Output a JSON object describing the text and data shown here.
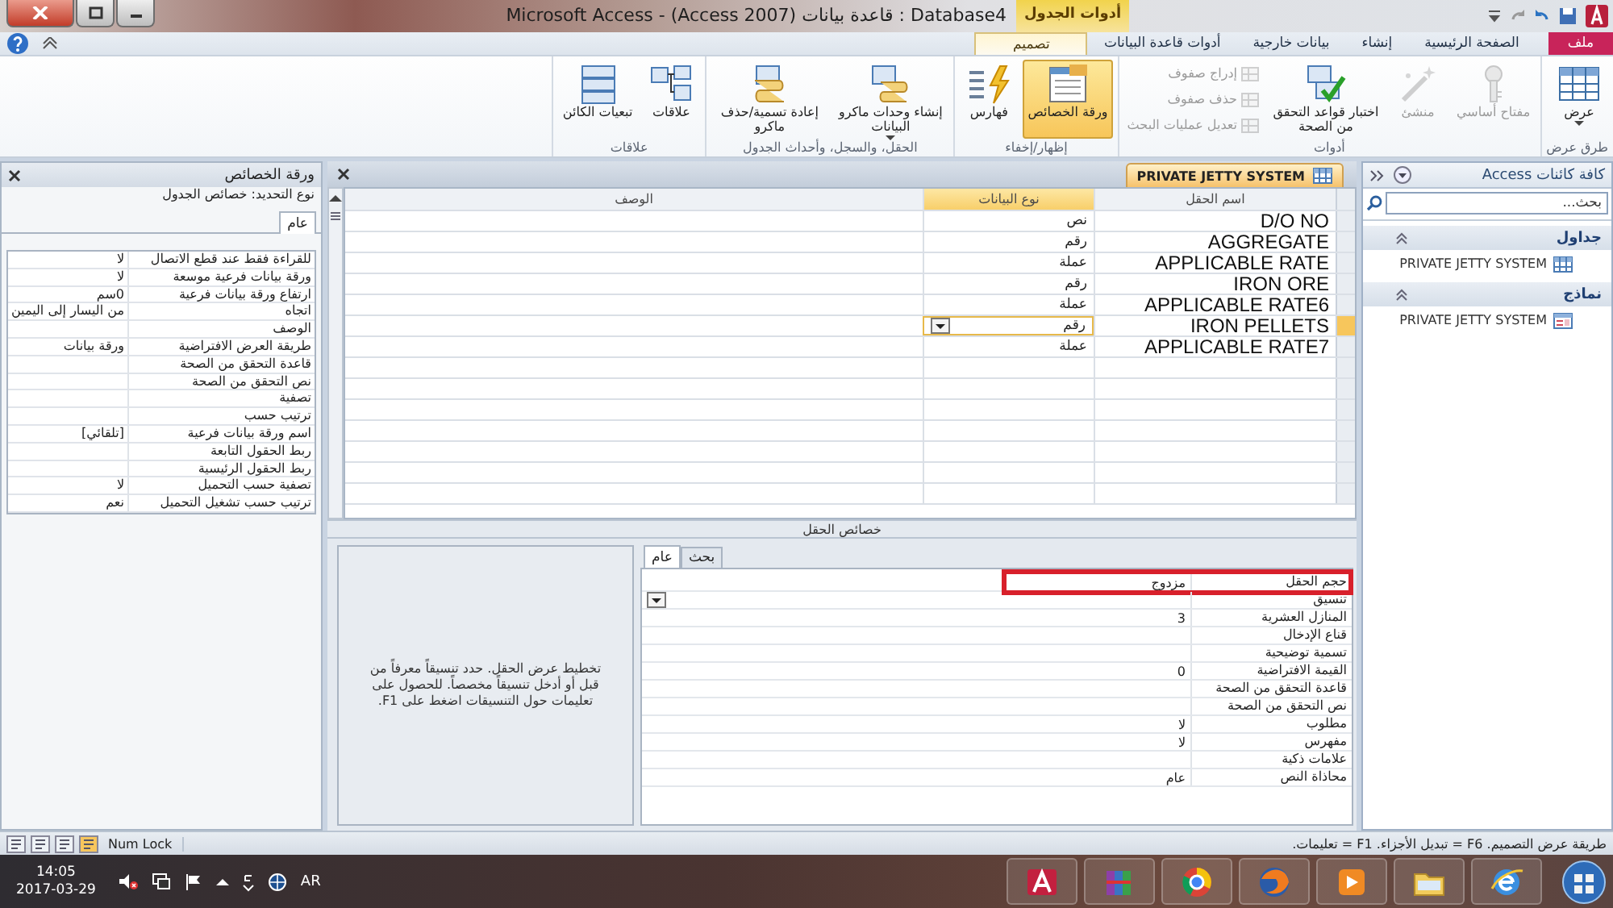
{
  "window": {
    "title": "Microsoft Access - (Access 2007) قاعدة بيانات : Database4",
    "contextual_label": "أدوات الجدول"
  },
  "ribbon_tabs": [
    {
      "label": "ملف",
      "kind": "file",
      "selected": false
    },
    {
      "label": "الصفحة الرئيسية",
      "kind": "tab",
      "selected": false
    },
    {
      "label": "إنشاء",
      "kind": "tab",
      "selected": false
    },
    {
      "label": "بيانات خارجية",
      "kind": "tab",
      "selected": false
    },
    {
      "label": "أدوات قاعدة البيانات",
      "kind": "tab",
      "selected": false
    },
    {
      "label": "تصميم",
      "kind": "tab",
      "selected": true
    }
  ],
  "ribbon_groups": [
    {
      "label": "طرق عرض",
      "buttons": [
        {
          "label": "عرض",
          "kind": "large",
          "disabled": false,
          "selected": false,
          "dropdown": true
        }
      ]
    },
    {
      "label": "أدوات",
      "buttons": [
        {
          "label": "مفتاح أساسي",
          "kind": "large",
          "disabled": true,
          "selected": false,
          "dropdown": false
        },
        {
          "label": "منشئ",
          "kind": "large",
          "disabled": true,
          "selected": false,
          "dropdown": false
        },
        {
          "label": "اختبار قواعد التحقق من الصحة",
          "kind": "large",
          "disabled": false,
          "selected": false,
          "dropdown": false
        },
        {
          "label": "إدراج صفوف",
          "kind": "small",
          "disabled": true,
          "selected": false,
          "dropdown": false
        },
        {
          "label": "حذف صفوف",
          "kind": "small",
          "disabled": true,
          "selected": false,
          "dropdown": false
        },
        {
          "label": "تعديل عمليات البحث",
          "kind": "small",
          "disabled": true,
          "selected": false,
          "dropdown": false
        }
      ]
    },
    {
      "label": "إظهار/إخفاء",
      "buttons": [
        {
          "label": "ورقة الخصائص",
          "kind": "large",
          "disabled": false,
          "selected": true,
          "dropdown": false
        },
        {
          "label": "فهارس",
          "kind": "large",
          "disabled": false,
          "selected": false,
          "dropdown": false
        }
      ]
    },
    {
      "label": "الحقل، والسجل، وأحداث الجدول",
      "buttons": [
        {
          "label": "إنشاء وحدات ماكرو البيانات",
          "kind": "large",
          "disabled": false,
          "selected": false,
          "dropdown": true
        },
        {
          "label": "إعادة تسمية/حذف ماكرو",
          "kind": "large",
          "disabled": false,
          "selected": false,
          "dropdown": false
        }
      ]
    },
    {
      "label": "علاقات",
      "buttons": [
        {
          "label": "علاقات",
          "kind": "large",
          "disabled": false,
          "selected": false,
          "dropdown": false
        },
        {
          "label": "تبعيات الكائن",
          "kind": "large",
          "disabled": false,
          "selected": false,
          "dropdown": false
        }
      ]
    }
  ],
  "navigation_pane": {
    "title": "كافة كائنات Access",
    "search": {
      "placeholder": "بحث..."
    },
    "sections": [
      {
        "label": "جداول",
        "expanded": true,
        "items": [
          {
            "label": "PRIVATE JETTY SYSTEM",
            "kind": "table"
          }
        ]
      },
      {
        "label": "نماذج",
        "expanded": true,
        "items": [
          {
            "label": "PRIVATE JETTY SYSTEM",
            "kind": "form"
          }
        ]
      }
    ]
  },
  "document": {
    "tab": "PRIVATE JETTY SYSTEM",
    "columns": [
      {
        "label": "اسم الحقل",
        "selected": false
      },
      {
        "label": "نوع البيانات",
        "selected": true
      },
      {
        "label": "الوصف",
        "selected": false
      }
    ],
    "rows": [
      {
        "name": "D/O NO",
        "type": "نص",
        "selected": false
      },
      {
        "name": "AGGREGATE",
        "type": "رقم",
        "selected": false
      },
      {
        "name": "APPLICABLE RATE",
        "type": "عملة",
        "selected": false
      },
      {
        "name": "IRON ORE",
        "type": "رقم",
        "selected": false
      },
      {
        "name": "APPLICABLE RATE6",
        "type": "عملة",
        "selected": false
      },
      {
        "name": "IRON PELLETS",
        "type": "رقم",
        "selected": true
      },
      {
        "name": "APPLICABLE RATE7",
        "type": "عملة",
        "selected": false
      }
    ]
  },
  "field_properties": {
    "title": "خصائص الحقل",
    "tabs": [
      {
        "label": "بحث",
        "selected": false
      },
      {
        "label": "عام",
        "selected": true
      }
    ],
    "rows": [
      {
        "label": "حجم الحقل",
        "value": "مزدوج",
        "kind": "text",
        "highlighted": true
      },
      {
        "label": "تنسيق",
        "kind": "dropdown",
        "highlighted": false
      },
      {
        "label": "المنازل العشرية",
        "value": "3",
        "kind": "text",
        "highlighted": false
      },
      {
        "label": "قناع الإدخال",
        "kind": "text",
        "highlighted": false
      },
      {
        "label": "تسمية توضيحية",
        "kind": "text",
        "highlighted": false
      },
      {
        "label": "القيمة الافتراضية",
        "value": "0",
        "kind": "text",
        "highlighted": false
      },
      {
        "label": "قاعدة التحقق من الصحة",
        "kind": "text",
        "highlighted": false
      },
      {
        "label": "نص التحقق من الصحة",
        "kind": "text",
        "highlighted": false
      },
      {
        "label": "مطلوب",
        "value": "لا",
        "kind": "text",
        "highlighted": false
      },
      {
        "label": "مفهرس",
        "value": "لا",
        "kind": "text",
        "highlighted": false
      },
      {
        "label": "علامات ذكية",
        "kind": "text",
        "highlighted": false
      },
      {
        "label": "محاذاة النص",
        "value": "عام",
        "kind": "text",
        "highlighted": false
      }
    ],
    "help": "تخطيط عرض الحقل. حدد تنسيقاً معرفاً من قبل أو أدخل تنسيقاً مخصصاً. للحصول على تعليمات حول التنسيقات اضغط على F1."
  },
  "property_sheet": {
    "title": "ورقة الخصائص",
    "selection_type": "نوع التحديد:  خصائص الجدول",
    "tabs": [
      {
        "label": "عام",
        "selected": true
      }
    ],
    "rows": [
      {
        "label": "للقراءة فقط عند قطع الاتصال",
        "value": "لا"
      },
      {
        "label": "ورقة بيانات فرعية موسعة",
        "value": "لا"
      },
      {
        "label": "ارتفاع ورقة بيانات فرعية",
        "value": "0سم"
      },
      {
        "label": "اتجاه",
        "value": "من اليسار إلى اليمين"
      },
      {
        "label": "الوصف"
      },
      {
        "label": "طريقة العرض الافتراضية",
        "value": "ورقة بيانات"
      },
      {
        "label": "قاعدة التحقق من الصحة"
      },
      {
        "label": "نص التحقق من الصحة"
      },
      {
        "label": "تصفية"
      },
      {
        "label": "ترتيب حسب"
      },
      {
        "label": "اسم ورقة بيانات فرعية",
        "value": "[تلقائي]"
      },
      {
        "label": "ربط الحقول التابعة"
      },
      {
        "label": "ربط الحقول الرئيسية"
      },
      {
        "label": "تصفية حسب التحميل",
        "value": "لا"
      },
      {
        "label": "ترتيب حسب تشغيل التحميل",
        "value": "نعم"
      }
    ]
  },
  "status_bar": {
    "message": "طريقة عرض التصميم. F6 = تبديل الأجزاء. F1 = تعليمات.",
    "indicator": "Num Lock"
  },
  "taskbar": {
    "time": "14:05",
    "date": "2017-03-29",
    "language": "AR"
  }
}
